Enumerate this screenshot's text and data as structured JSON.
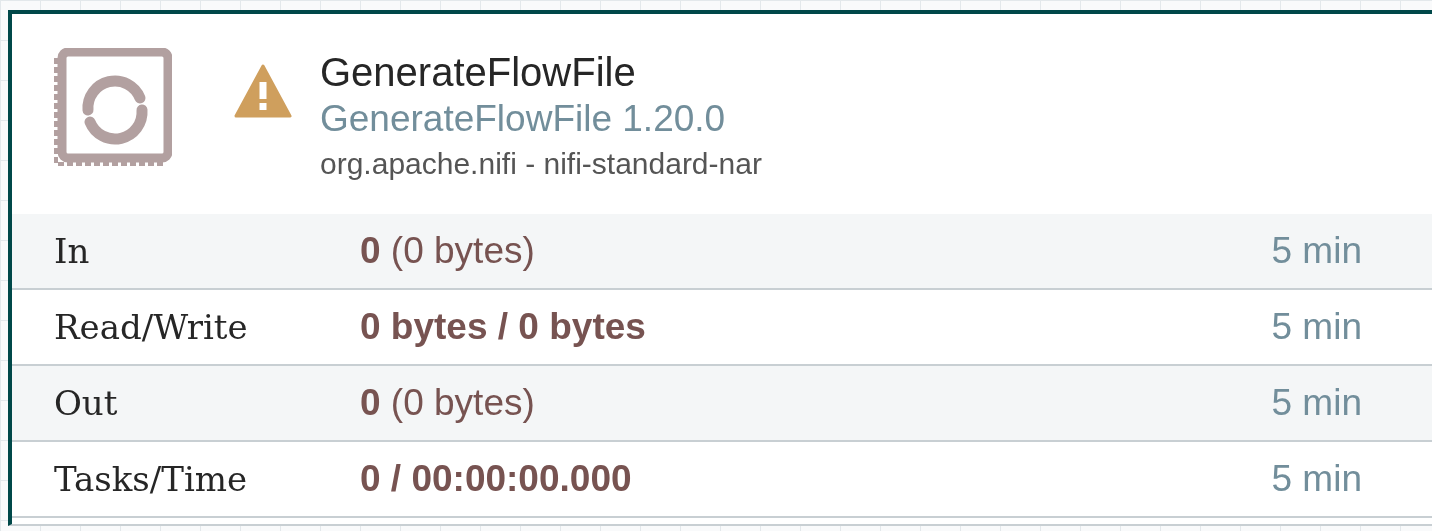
{
  "processor": {
    "name": "GenerateFlowFile",
    "type": "GenerateFlowFile 1.20.0",
    "bundle": "org.apache.nifi - nifi-standard-nar",
    "warning": true
  },
  "stats": [
    {
      "label": "In",
      "value": "**0** (0 bytes)",
      "bold": false,
      "window": "5 min"
    },
    {
      "label": "Read/Write",
      "value": "0 bytes / 0 bytes",
      "bold": true,
      "window": "5 min"
    },
    {
      "label": "Out",
      "value": "**0** (0 bytes)",
      "bold": false,
      "window": "5 min"
    },
    {
      "label": "Tasks/Time",
      "value": "0 / 00:00:00.000",
      "bold": true,
      "window": "5 min"
    }
  ]
}
